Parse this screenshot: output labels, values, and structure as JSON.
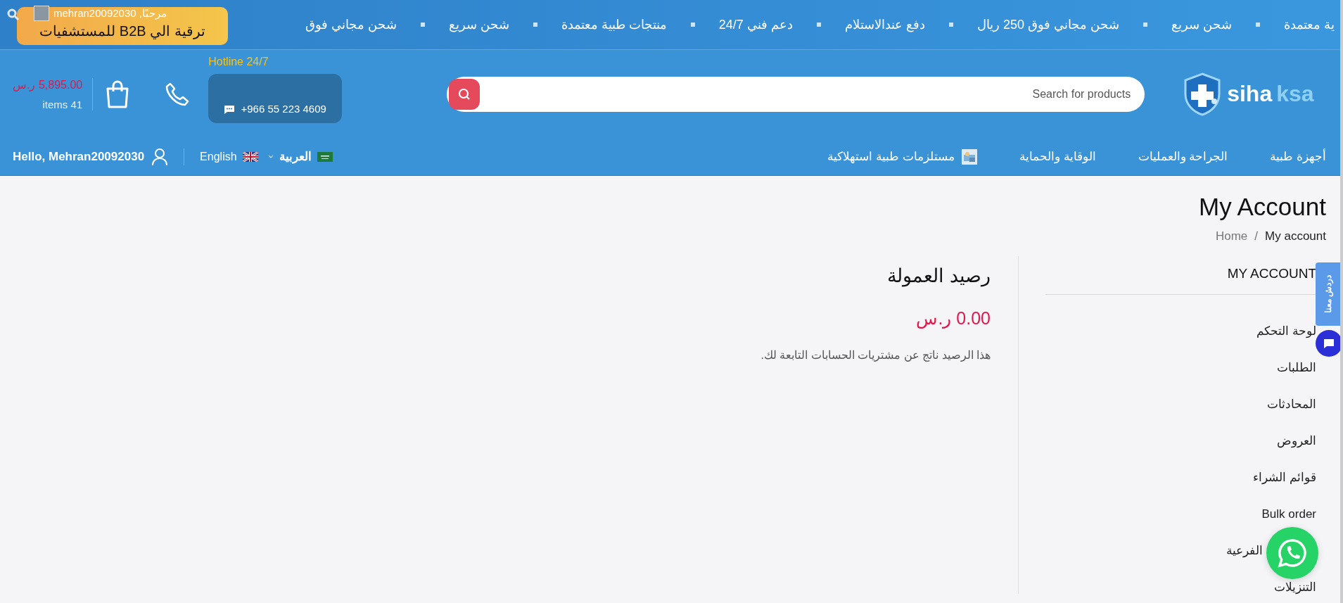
{
  "top_bar": {
    "ticker": [
      "ية معتمدة",
      "شحن سريع",
      "شحن مجاني فوق 250 ريال",
      "دفع عندالاستلام",
      "دعم فني 24/7",
      "منتجات طبية معتمدة",
      "شحن سريع",
      "شحن مجاني فوق"
    ],
    "upgrade_button": "ترقية الي B2B للمستشفيات",
    "greeting": "مرحبًا, mehran20092030"
  },
  "header": {
    "logo": {
      "name": "siha",
      "suffix": "ksa"
    },
    "search": {
      "placeholder": "Search for products"
    },
    "hotline": {
      "label": "Hotline 24/7",
      "phone": "+966 55 223 4609"
    },
    "cart": {
      "total": "5,895.00 ر.س",
      "items": "items 41"
    }
  },
  "nav": {
    "items": [
      {
        "label": "أجهزة طبية",
        "kind": "text"
      },
      {
        "label": "الجراحة والعمليات",
        "kind": "text"
      },
      {
        "label": "الوقاية والحماية",
        "kind": "text"
      },
      {
        "label": "مستلزمات طبية استهلاكية"
      }
    ],
    "languages": [
      {
        "label": "العربية",
        "kind": "sa"
      },
      {
        "label": "English",
        "kind": "uk"
      }
    ],
    "user": "Hello, Mehran20092030"
  },
  "page": {
    "title": "My Account",
    "breadcrumb": [
      "My account",
      "Home"
    ],
    "breadcrumb_separator": "/"
  },
  "sidebar": {
    "title": "MY ACCOUNT",
    "items": [
      {
        "label": "لوحة التحكم",
        "kind": "plain"
      },
      {
        "label": "الطلبات",
        "kind": "plain"
      },
      {
        "label": "المحادثات",
        "kind": "plain"
      },
      {
        "label": "العروض",
        "kind": "plain"
      },
      {
        "label": "قوائم الشراء",
        "kind": "plain"
      },
      {
        "label": "Bulk order",
        "kind": "plain"
      },
      {
        "label": "الفرعية",
        "kind": "covered"
      },
      {
        "label": "التنزيلات",
        "kind": "plain"
      }
    ]
  },
  "main": {
    "title": "رصيد العمولة",
    "amount": "0.00 ر.س",
    "note": "هذا الرصيد ناتج عن مشتريات الحسابات التابعة لك."
  },
  "chat_tab": "دردش معنا"
}
